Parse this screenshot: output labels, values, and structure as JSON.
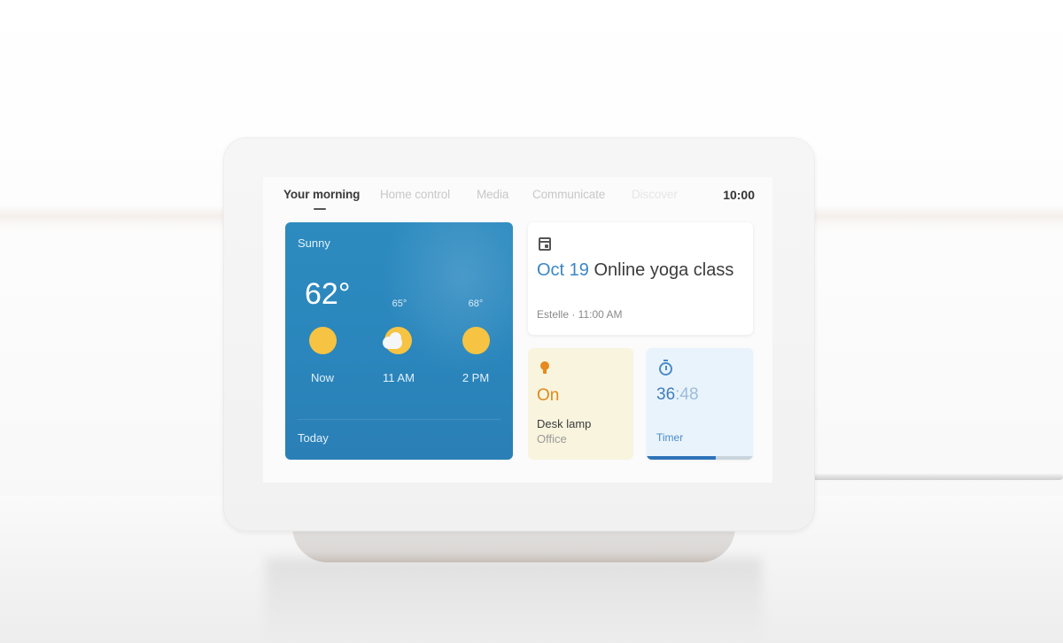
{
  "screen": {
    "tabs": [
      {
        "label": "Your morning",
        "active": true
      },
      {
        "label": "Home control",
        "active": false
      },
      {
        "label": "Media",
        "active": false
      },
      {
        "label": "Communicate",
        "active": false
      },
      {
        "label": "Discover",
        "active": false
      }
    ],
    "clock": "10:00"
  },
  "weather": {
    "condition": "Sunny",
    "current_temp": "62°",
    "forecast": [
      {
        "time": "Now",
        "temp": "",
        "icon": "sun-icon"
      },
      {
        "time": "11 AM",
        "temp": "65°",
        "icon": "partly-cloudy-icon"
      },
      {
        "time": "2 PM",
        "temp": "68°",
        "icon": "sun-icon"
      }
    ],
    "footer": "Today",
    "colors": {
      "card": "#2d8bbf",
      "sun": "#f6c342"
    }
  },
  "event": {
    "icon": "calendar-icon",
    "date": "Oct 19",
    "title": "Online yoga class",
    "meta": "Estelle · 11:00 AM",
    "colors": {
      "date": "#3b86c6"
    }
  },
  "lamp": {
    "icon": "lightbulb-icon",
    "state": "On",
    "name": "Desk lamp",
    "room": "Office",
    "colors": {
      "card": "#f8f4de",
      "accent": "#e08a1a"
    }
  },
  "timer": {
    "icon": "stopwatch-icon",
    "minutes": "36",
    "separator": ":",
    "seconds": "48",
    "label": "Timer",
    "progress": 0.65,
    "colors": {
      "card": "#e9f3fb",
      "accent": "#2e73b8"
    }
  }
}
